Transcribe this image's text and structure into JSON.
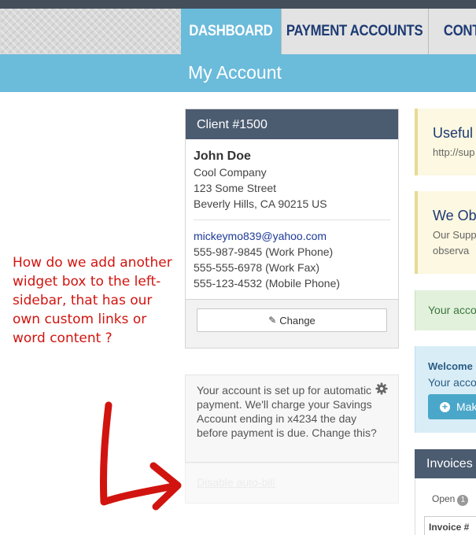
{
  "nav": {
    "tabs": [
      {
        "label": "DASHBOARD",
        "active": true
      },
      {
        "label": "PAYMENT ACCOUNTS",
        "active": false
      },
      {
        "label": "CONTA",
        "active": false
      }
    ]
  },
  "page": {
    "title": "My Account"
  },
  "annotation": {
    "text": "How do we  add another widget box to the left-sidebar, that has our own custom links or word content ?",
    "color": "#d1140f"
  },
  "client": {
    "header": "Client #1500",
    "name": "John Doe",
    "company": "Cool Company",
    "street": "123 Some Street",
    "city": "Beverly Hills, CA 90215 US",
    "email": "mickeymo839@yahoo.com",
    "phones": [
      "555-987-9845 (Work Phone)",
      "555-555-6978 (Work Fax)",
      "555-123-4532 (Mobile Phone)"
    ],
    "change_label": "Change"
  },
  "autopay": {
    "text": "Your account is set up for automatic payment. We'll charge your Savings Account ending in x4234 the day before payment is due. Change this?",
    "faded_link": "Disable auto-bill"
  },
  "right": {
    "useful_title": "Useful",
    "useful_sub": "http://sup",
    "observe_title": "We Ob",
    "observe_line1": "Our Supp",
    "observe_line2": "observa",
    "success_text": "Your acco",
    "welcome_title": "Welcome",
    "welcome_text": "Your acco",
    "make_button": "Mak",
    "invoices_title": "Invoices",
    "open_label": "Open",
    "open_count": "1",
    "invoice_col": "Invoice #"
  },
  "colors": {
    "nav_active": "#6bbbdb",
    "nav_text": "#1d3a73",
    "card_header": "#4b5b70",
    "page_bar": "#6bbbdb"
  },
  "icons": {
    "gear": "gear-icon",
    "pencil": "pencil-icon",
    "arrow": "hand-drawn-arrow-icon"
  }
}
